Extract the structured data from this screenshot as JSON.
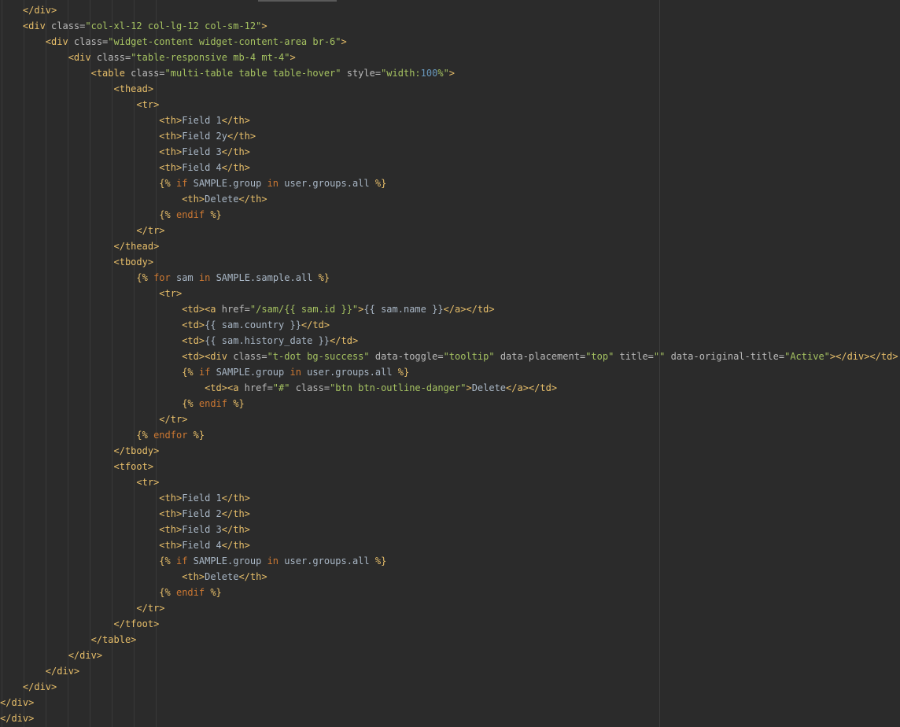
{
  "editor": {
    "lines": [
      [
        [
          "tag",
          "    </div>"
        ]
      ],
      [
        [
          "tag",
          "    <div "
        ],
        [
          "attr",
          "class="
        ],
        [
          "str",
          "\"col-xl-12 col-lg-12 col-sm-12\""
        ],
        [
          "tag",
          ">"
        ]
      ],
      [
        [
          "tag",
          "        <div "
        ],
        [
          "attr",
          "class="
        ],
        [
          "str",
          "\"widget-content widget-content-area br-6\""
        ],
        [
          "tag",
          ">"
        ]
      ],
      [
        [
          "tag",
          "            <div "
        ],
        [
          "attr",
          "class="
        ],
        [
          "str",
          "\"table-responsive mb-4 mt-4\""
        ],
        [
          "tag",
          ">"
        ]
      ],
      [
        [
          "tag",
          "                <table "
        ],
        [
          "attr",
          "class="
        ],
        [
          "str",
          "\"multi-table table table-hover\" "
        ],
        [
          "attr",
          "style="
        ],
        [
          "str",
          "\"width:"
        ],
        [
          "num",
          "100"
        ],
        [
          "str",
          "%\""
        ],
        [
          "tag",
          ">"
        ]
      ],
      [
        [
          "tag",
          "                    <thead>"
        ]
      ],
      [
        [
          "tag",
          "                        <tr>"
        ]
      ],
      [
        [
          "tag",
          "                            <th>"
        ],
        [
          "txt",
          "Field 1"
        ],
        [
          "tag",
          "</th>"
        ]
      ],
      [
        [
          "tag",
          "                            <th>"
        ],
        [
          "txt",
          "Field 2y"
        ],
        [
          "tag",
          "</th>"
        ]
      ],
      [
        [
          "tag",
          "                            <th>"
        ],
        [
          "txt",
          "Field 3"
        ],
        [
          "tag",
          "</th>"
        ]
      ],
      [
        [
          "tag",
          "                            <th>"
        ],
        [
          "txt",
          "Field 4"
        ],
        [
          "tag",
          "</th>"
        ]
      ],
      [
        [
          "tpl",
          "                            {% "
        ],
        [
          "kw",
          "if "
        ],
        [
          "txt",
          "SAMPLE.group "
        ],
        [
          "kw",
          "in "
        ],
        [
          "txt",
          "user.groups.all "
        ],
        [
          "tpl",
          "%}"
        ]
      ],
      [
        [
          "tag",
          "                                <th>"
        ],
        [
          "txt",
          "Delete"
        ],
        [
          "tag",
          "</th>"
        ]
      ],
      [
        [
          "tpl",
          "                            {% "
        ],
        [
          "kw",
          "endif "
        ],
        [
          "tpl",
          "%}"
        ]
      ],
      [
        [
          "tag",
          "                        </tr>"
        ]
      ],
      [
        [
          "tag",
          "                    </thead>"
        ]
      ],
      [
        [
          "tag",
          "                    <tbody>"
        ]
      ],
      [
        [
          "tpl",
          "                        {% "
        ],
        [
          "kw",
          "for "
        ],
        [
          "txt",
          "sam "
        ],
        [
          "kw",
          "in "
        ],
        [
          "txt",
          "SAMPLE.sample.all "
        ],
        [
          "tpl",
          "%}"
        ]
      ],
      [
        [
          "tag",
          "                            <tr>"
        ]
      ],
      [
        [
          "tag",
          "                                <td><a "
        ],
        [
          "attr",
          "href="
        ],
        [
          "str",
          "\"/sam/{{ sam.id }}\""
        ],
        [
          "tag",
          ">"
        ],
        [
          "txt",
          "{{ sam.name }}"
        ],
        [
          "tag",
          "</a></td>"
        ]
      ],
      [
        [
          "tag",
          "                                <td>"
        ],
        [
          "txt",
          "{{ sam.country }}"
        ],
        [
          "tag",
          "</td>"
        ]
      ],
      [
        [
          "tag",
          "                                <td>"
        ],
        [
          "txt",
          "{{ sam.history_date }}"
        ],
        [
          "tag",
          "</td>"
        ]
      ],
      [
        [
          "tag",
          "                                <td><div "
        ],
        [
          "attr",
          "class="
        ],
        [
          "str",
          "\"t-dot bg-success\" "
        ],
        [
          "attr",
          "data-toggle="
        ],
        [
          "str",
          "\"tooltip\" "
        ],
        [
          "attr",
          "data-placement="
        ],
        [
          "str",
          "\"top\" "
        ],
        [
          "attr",
          "title="
        ],
        [
          "str",
          "\"\" "
        ],
        [
          "attr",
          "data-original-title="
        ],
        [
          "str",
          "\"Active\""
        ],
        [
          "tag",
          "></div></td>"
        ]
      ],
      [
        [
          "tpl",
          "                                {% "
        ],
        [
          "kw",
          "if "
        ],
        [
          "txt",
          "SAMPLE.group "
        ],
        [
          "kw",
          "in "
        ],
        [
          "txt",
          "user.groups.all "
        ],
        [
          "tpl",
          "%}"
        ]
      ],
      [
        [
          "tag",
          "                                    <td><a "
        ],
        [
          "attr",
          "href="
        ],
        [
          "str",
          "\"#\" "
        ],
        [
          "attr",
          "class="
        ],
        [
          "str",
          "\"btn btn-outline-danger\""
        ],
        [
          "tag",
          ">"
        ],
        [
          "txt",
          "Delete"
        ],
        [
          "tag",
          "</a></td>"
        ]
      ],
      [
        [
          "tpl",
          "                                {% "
        ],
        [
          "kw",
          "endif "
        ],
        [
          "tpl",
          "%}"
        ]
      ],
      [
        [
          "tag",
          "                            </tr>"
        ]
      ],
      [
        [
          "tpl",
          "                        {% "
        ],
        [
          "kw",
          "endfor "
        ],
        [
          "tpl",
          "%}"
        ]
      ],
      [
        [
          "tag",
          "                    </tbody>"
        ]
      ],
      [
        [
          "tag",
          "                    <tfoot>"
        ]
      ],
      [
        [
          "tag",
          "                        <tr>"
        ]
      ],
      [
        [
          "tag",
          "                            <th>"
        ],
        [
          "txt",
          "Field 1"
        ],
        [
          "tag",
          "</th>"
        ]
      ],
      [
        [
          "tag",
          "                            <th>"
        ],
        [
          "txt",
          "Field 2"
        ],
        [
          "tag",
          "</th>"
        ]
      ],
      [
        [
          "tag",
          "                            <th>"
        ],
        [
          "txt",
          "Field 3"
        ],
        [
          "tag",
          "</th>"
        ]
      ],
      [
        [
          "tag",
          "                            <th>"
        ],
        [
          "txt",
          "Field 4"
        ],
        [
          "tag",
          "</th>"
        ]
      ],
      [
        [
          "tpl",
          "                            {% "
        ],
        [
          "kw",
          "if "
        ],
        [
          "txt",
          "SAMPLE.group "
        ],
        [
          "kw",
          "in "
        ],
        [
          "txt",
          "user.groups.all "
        ],
        [
          "tpl",
          "%}"
        ]
      ],
      [
        [
          "tag",
          "                                <th>"
        ],
        [
          "txt",
          "Delete"
        ],
        [
          "tag",
          "</th>"
        ]
      ],
      [
        [
          "tpl",
          "                            {% "
        ],
        [
          "kw",
          "endif "
        ],
        [
          "tpl",
          "%}"
        ]
      ],
      [
        [
          "tag",
          "                        </tr>"
        ]
      ],
      [
        [
          "tag",
          "                    </tfoot>"
        ]
      ],
      [
        [
          "tag",
          "                </table>"
        ]
      ],
      [
        [
          "tag",
          "            </div>"
        ]
      ],
      [
        [
          "tag",
          "        </div>"
        ]
      ],
      [
        [
          "tag",
          "    </div>"
        ]
      ],
      [
        [
          "tag",
          "</div>"
        ]
      ],
      [
        [
          "tag",
          "</div>"
        ]
      ]
    ]
  }
}
